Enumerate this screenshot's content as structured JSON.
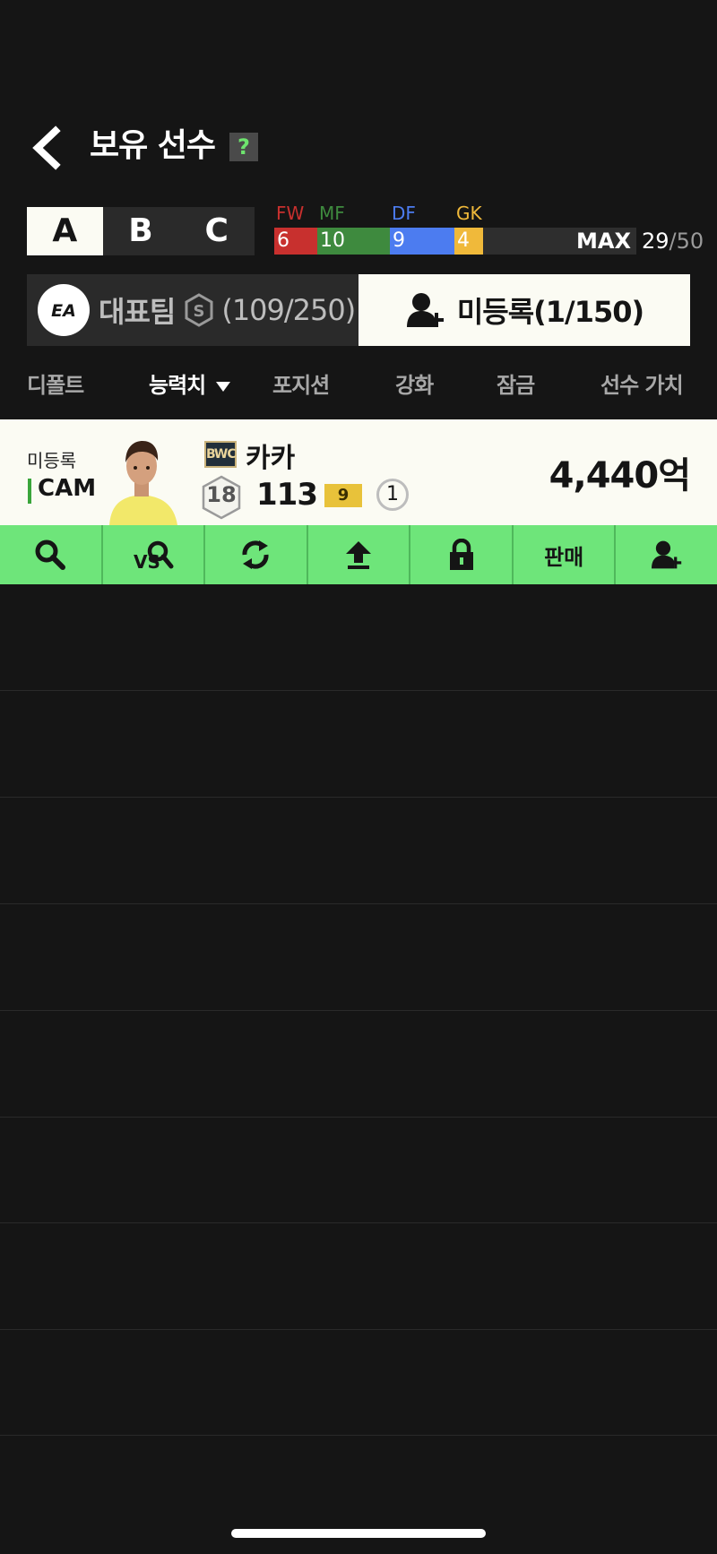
{
  "header": {
    "title": "보유 선수",
    "help": "?"
  },
  "squad_tabs": [
    "A",
    "B",
    "C"
  ],
  "active_squad": "A",
  "positions": {
    "labels": {
      "fw": "FW",
      "mf": "MF",
      "df": "DF",
      "gk": "GK"
    },
    "values": {
      "fw": "6",
      "mf": "10",
      "df": "9",
      "gk": "4"
    },
    "colors": {
      "fw": "#c8302e",
      "mf": "#3e8a3e",
      "df": "#4c7cf0",
      "gk": "#f0b93a"
    },
    "max_label": "MAX",
    "used": "29",
    "separator": "/",
    "max": "50"
  },
  "team": {
    "name": "대표팀",
    "count": "(109/250)"
  },
  "unregistered": {
    "label": "미등록(1/150)"
  },
  "sort_tabs": {
    "default": "디폴트",
    "ability": "능력치",
    "position": "포지션",
    "enhance": "강화",
    "lock": "잠금",
    "value": "선수 가치"
  },
  "player": {
    "status": "미등록",
    "position": "CAM",
    "season": "BWC",
    "name": "카카",
    "level": "18",
    "ovr": "113",
    "grade": "9",
    "count": "1",
    "price": "4,440억"
  },
  "actions": {
    "sell": "판매"
  },
  "icons": [
    "back-icon",
    "ea-logo-icon",
    "shield-s-icon",
    "user-add-icon",
    "search-icon",
    "vs-compare-icon",
    "swap-icon",
    "upgrade-arrow-icon",
    "lock-icon"
  ]
}
